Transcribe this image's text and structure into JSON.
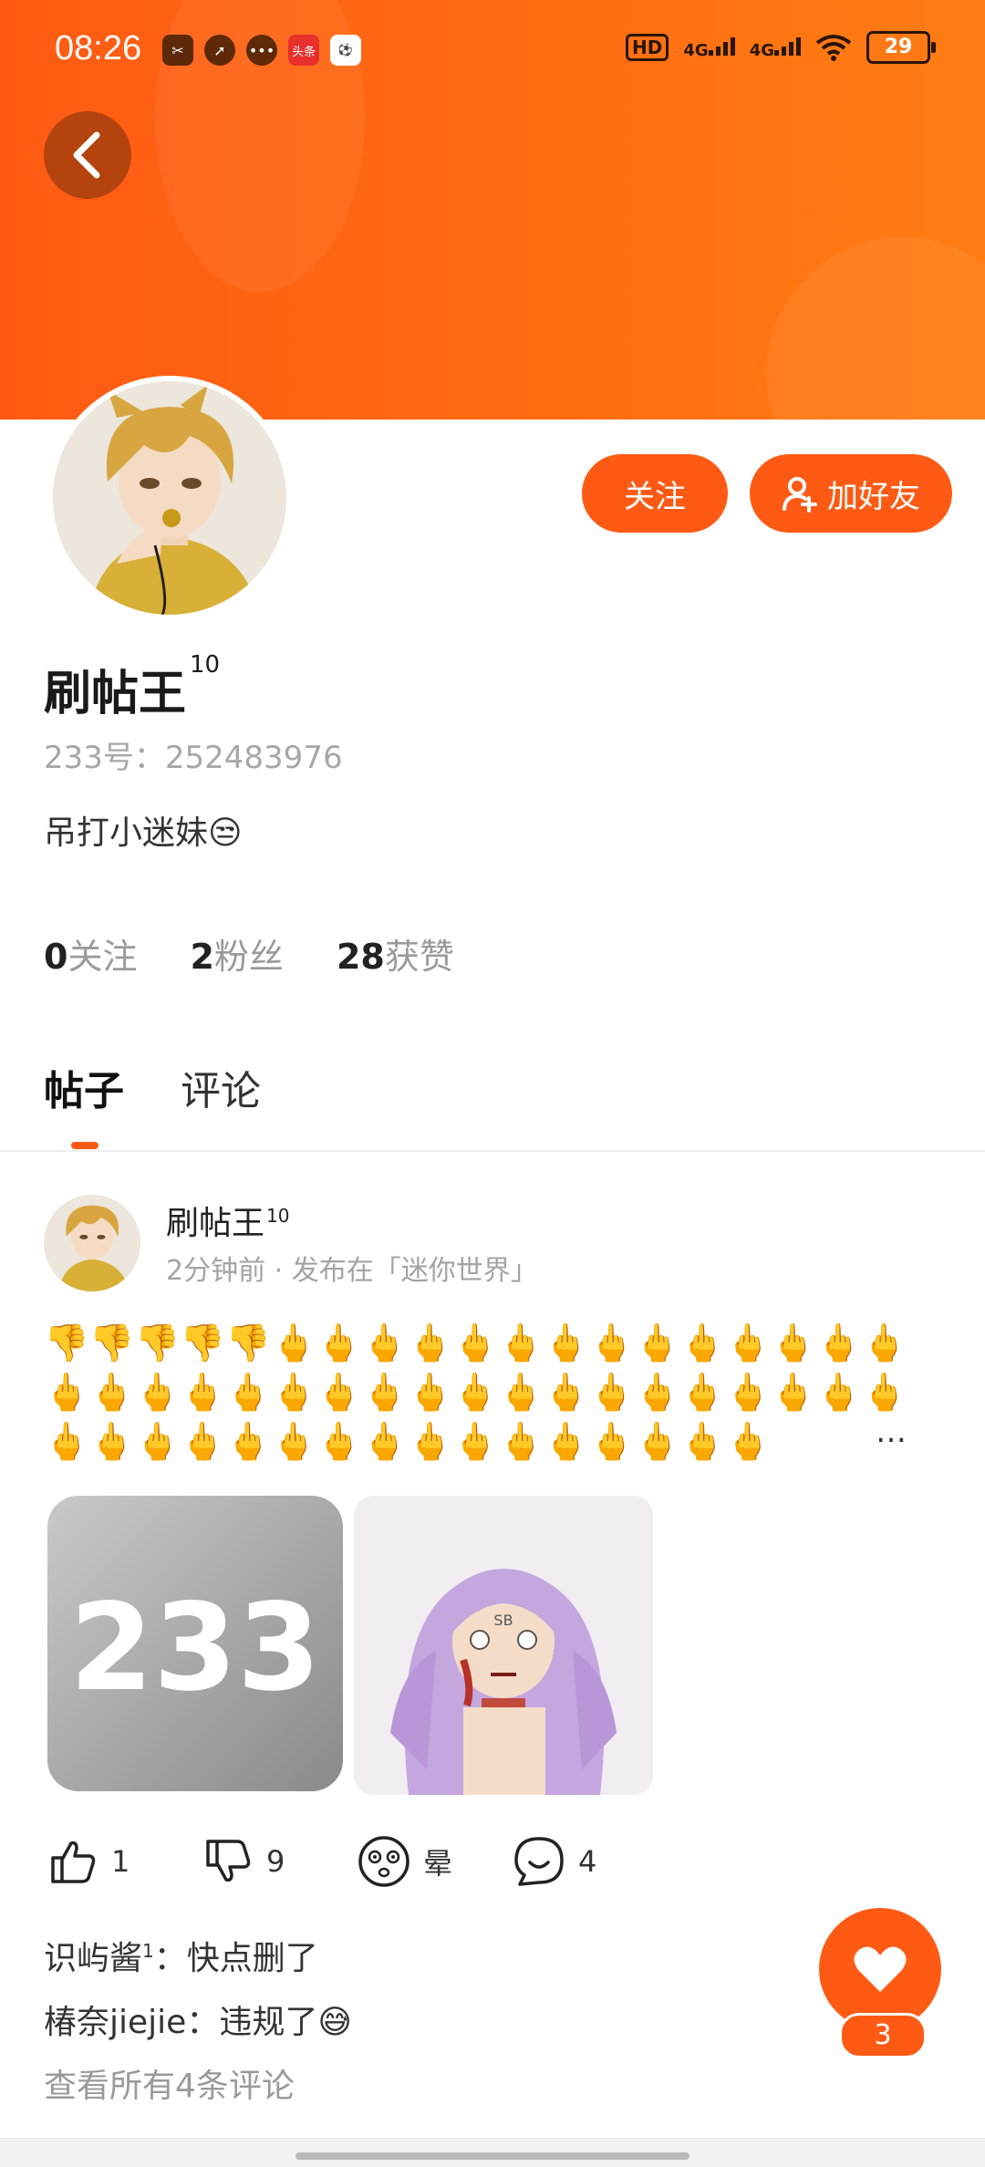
{
  "status": {
    "time": "08:26",
    "left_icons": [
      "✂",
      "➚",
      "•••",
      "头条",
      "⚽"
    ],
    "hd": "HD",
    "net1": "4G",
    "net2": "4G",
    "battery": "29"
  },
  "header": {
    "accent": "#ff5a14"
  },
  "profile": {
    "name": "刷帖王",
    "level": "10",
    "id_text": "233号：252483976",
    "bio": "吊打小迷妹😒",
    "follow_button": "关注",
    "add_friend_button": "加好友",
    "stats": [
      {
        "num": "0",
        "label": "关注"
      },
      {
        "num": "2",
        "label": "粉丝"
      },
      {
        "num": "28",
        "label": "获赞"
      }
    ]
  },
  "tabs": [
    {
      "label": "帖子"
    },
    {
      "label": "评论"
    }
  ],
  "post": {
    "author": "刷帖王",
    "level": "10",
    "meta": "2分钟前 · 发布在「迷你世界」",
    "content": "👎👎👎👎👎🖕🖕🖕🖕🖕🖕🖕🖕🖕🖕🖕🖕🖕🖕🖕🖕🖕🖕🖕🖕🖕🖕🖕🖕🖕🖕🖕🖕🖕🖕🖕🖕🖕🖕🖕🖕🖕🖕🖕🖕🖕🖕🖕🖕🖕🖕🖕🖕🖕",
    "ellipsis": "…",
    "image1_text": "233",
    "image2_text": "SB",
    "actions": [
      {
        "icon": "thumb-up-icon",
        "value": "1"
      },
      {
        "icon": "thumb-down-icon",
        "value": "9"
      },
      {
        "icon": "dizzy-face-icon",
        "value": "晕"
      },
      {
        "icon": "comment-icon",
        "value": "4"
      }
    ],
    "comments": [
      {
        "user": "识屿酱",
        "sup": "1",
        "text": "：快点删了"
      },
      {
        "user": "椿奈jiejie",
        "sup": "",
        "text": "：违规了😅"
      }
    ],
    "view_all": "查看所有4条评论"
  },
  "like_fab": {
    "count": "3"
  }
}
